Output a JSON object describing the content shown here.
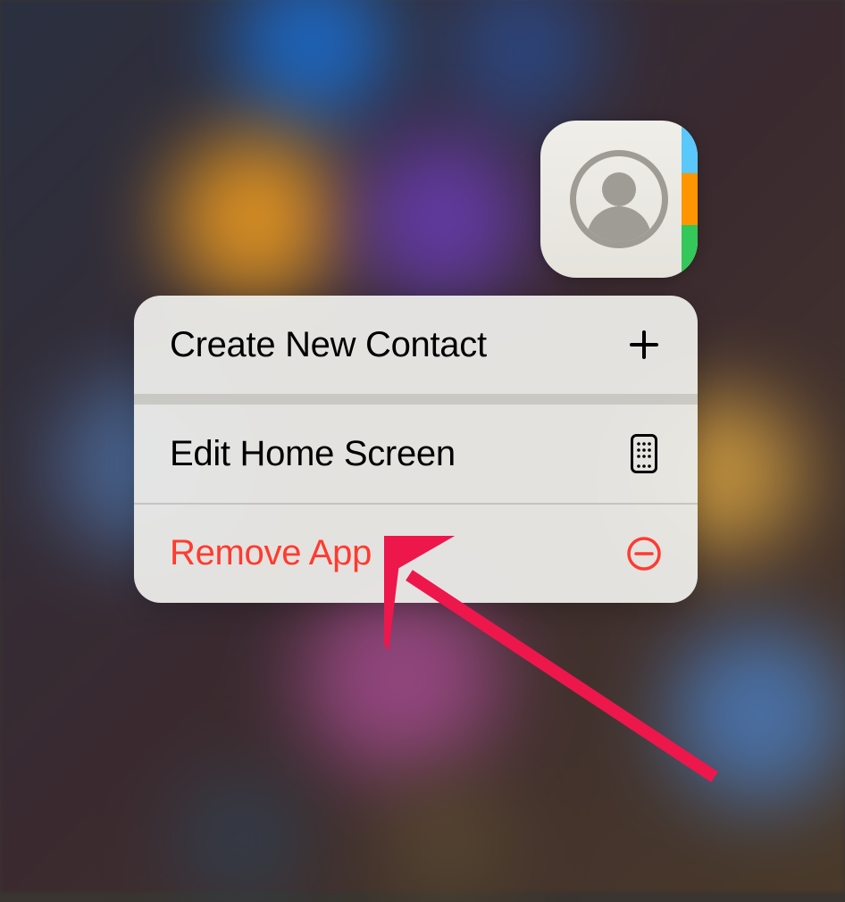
{
  "app": {
    "name": "Contacts"
  },
  "menu": {
    "items": [
      {
        "label": "Create New Contact",
        "icon": "plus-icon",
        "destructive": false
      },
      {
        "label": "Edit Home Screen",
        "icon": "phone-grid-icon",
        "destructive": false
      },
      {
        "label": "Remove App",
        "icon": "minus-circle-icon",
        "destructive": true
      }
    ]
  },
  "colors": {
    "destructive": "#ff3b30",
    "tab_blue": "#5ac8fa",
    "tab_orange": "#ff9500",
    "tab_green": "#34c759"
  }
}
